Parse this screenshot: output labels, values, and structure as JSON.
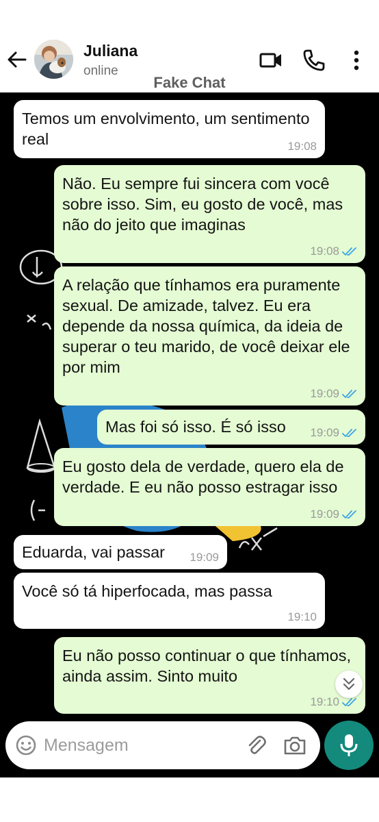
{
  "header": {
    "contact_name": "Juliana",
    "contact_status": "online",
    "app_title": "Fake Chat"
  },
  "messages": [
    {
      "direction": "in",
      "text": "Temos um envolvimento, um sentimento real",
      "time": "19:08"
    },
    {
      "direction": "out",
      "text": "Não. Eu sempre fui sincera com você sobre isso. Sim, eu gosto de você, mas não do jeito que imaginas",
      "time": "19:08",
      "status": "read"
    },
    {
      "direction": "out",
      "text": "A relação que tínhamos era puramente sexual. De amizade, talvez. Eu era depende da nossa química, da ideia de superar o teu marido, de você deixar ele por mim",
      "time": "19:09",
      "status": "read"
    },
    {
      "direction": "out",
      "text": "Mas foi só isso. É só isso",
      "time": "19:09",
      "status": "read"
    },
    {
      "direction": "out",
      "text": "Eu gosto dela de verdade, quero ela de verdade. E eu não posso estragar isso",
      "time": "19:09",
      "status": "read"
    },
    {
      "direction": "in",
      "text": "Eduarda, vai passar",
      "time": "19:09"
    },
    {
      "direction": "in",
      "text": "Você só tá hiperfocada, mas passa",
      "time": "19:10"
    },
    {
      "direction": "out",
      "text": "Eu não posso continuar o que tínhamos, ainda assim. Sinto muito",
      "time": "19:10",
      "status": "read"
    }
  ],
  "input": {
    "placeholder": "Mensagem"
  },
  "icons": {
    "back": "arrow-left-icon",
    "video": "video-call-icon",
    "phone": "phone-icon",
    "more": "more-vert-icon",
    "emoji": "emoji-icon",
    "attach": "paperclip-icon",
    "camera": "camera-icon",
    "mic": "mic-icon",
    "scroll": "chevron-double-down-icon",
    "ticks": "double-check-icon"
  },
  "colors": {
    "incoming_bubble": "#ffffff",
    "outgoing_bubble": "#e4fbd3",
    "read_ticks": "#3aa5e5",
    "mic_button": "#138a7c",
    "chat_background": "#000000"
  }
}
